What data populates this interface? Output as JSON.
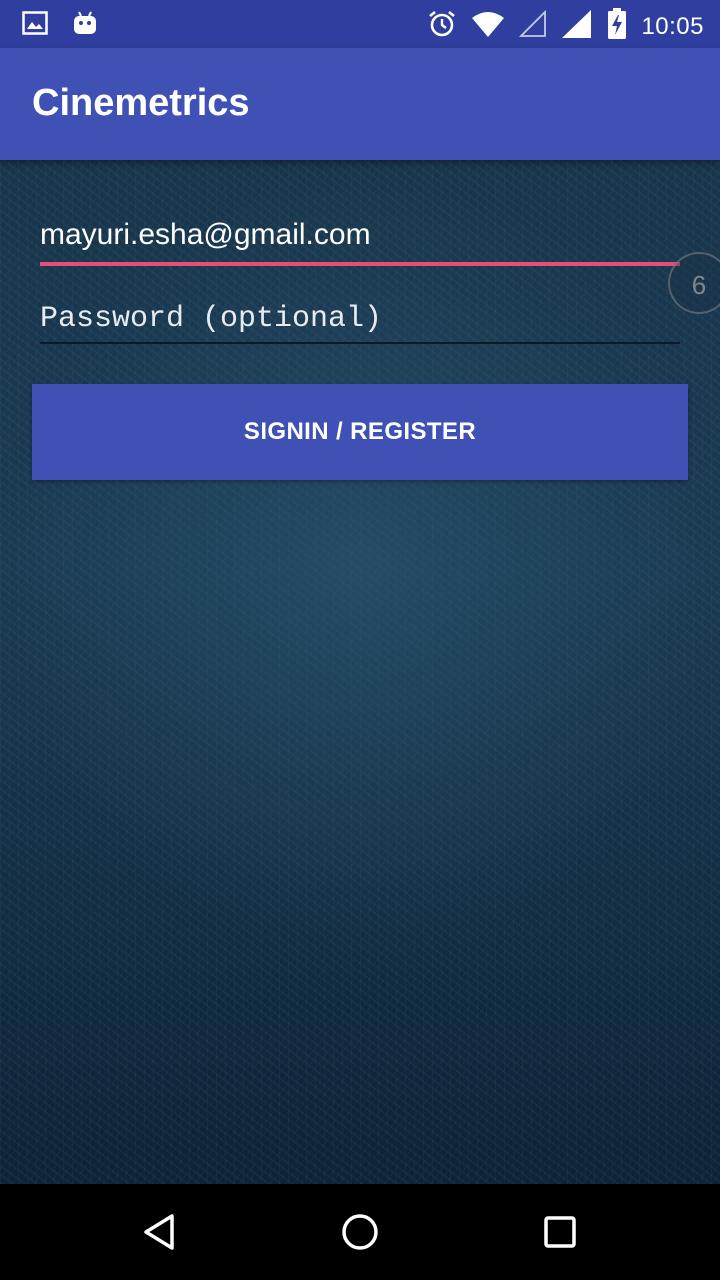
{
  "status_bar": {
    "time": "10:05",
    "icons": [
      "image-icon",
      "android-icon",
      "alarm-icon",
      "wifi-icon",
      "signal-empty-icon",
      "signal-full-icon",
      "battery-charging-icon"
    ]
  },
  "app_bar": {
    "title": "Cinemetrics"
  },
  "form": {
    "email_value": "mayuri.esha@gmail.com",
    "password_placeholder": "Password (optional)",
    "bubble_count": "6",
    "submit_label": "SIGNIN / REGISTER"
  },
  "colors": {
    "status_bar": "#303f9f",
    "app_bar": "#3f51b5",
    "accent": "#e84c78",
    "button": "#3f51b5"
  },
  "nav_bar": {
    "icons": [
      "back-icon",
      "home-icon",
      "recents-icon"
    ]
  }
}
